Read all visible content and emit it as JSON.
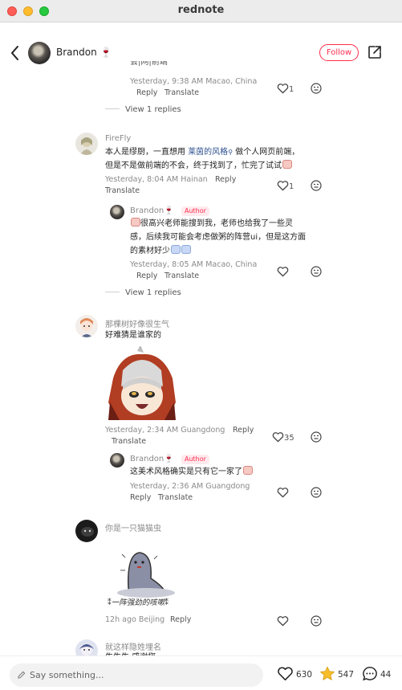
{
  "window": {
    "title": "rednote"
  },
  "header": {
    "author_name": "Brandon",
    "author_emoji": "🍷",
    "follow_label": "Follow"
  },
  "comments": {
    "c0": {
      "text_partial": "会|网|前端",
      "time_location": "Yesterday, 9:38 AM Macao, China",
      "reply": "Reply",
      "translate": "Translate",
      "likes": "1",
      "view_replies": "View 1 replies"
    },
    "c1": {
      "name": "FireFly",
      "text_a": "本人是缪厨，一直想用",
      "text_link": "莱茵的风格",
      "text_b": "做个人网页前端，",
      "text_line2": "但是不是做前端的不会，终于找到了，忙完了试试",
      "time_location": "Yesterday, 8:04 AM Hainan",
      "reply": "Reply",
      "translate": "Translate",
      "likes": "1",
      "sub": {
        "name": "Brandon",
        "name_emoji": "🍷",
        "badge": "Author",
        "line1": "很高兴老师能搜到我，老师也给我了一些灵",
        "line2": "感，后续我可能会考虑做粥的阵营ui，但是这方面",
        "line3": "的素材好少",
        "time_location": "Yesterday, 8:05 AM Macao, China",
        "reply": "Reply",
        "translate": "Translate"
      },
      "view_replies": "View 1 replies"
    },
    "c2": {
      "name": "那棵树好像很生气",
      "text": "好难猜是谁家的",
      "time_location": "Yesterday, 2:34 AM Guangdong",
      "reply": "Reply",
      "translate": "Translate",
      "likes": "35",
      "sub": {
        "name": "Brandon",
        "name_emoji": "🍷",
        "badge": "Author",
        "text": "这美术风格确实是只有它一家了",
        "time_location": "Yesterday, 2:36 AM Guangdong",
        "reply": "Reply",
        "translate": "Translate"
      }
    },
    "c3": {
      "name": "你是一只猫猫虫",
      "sticker_caption": "一阵强劲的咳嗽",
      "time_location": "12h ago Beijing",
      "reply": "Reply"
    },
    "c4": {
      "name": "就这样隐姓埋名",
      "text_partial": "生生生 感谢您"
    }
  },
  "bottom": {
    "placeholder": "Say something...",
    "likes": "630",
    "stars": "547",
    "comments": "44"
  },
  "colors": {
    "accent": "#ff2e4d",
    "link": "#2c4f8f"
  }
}
